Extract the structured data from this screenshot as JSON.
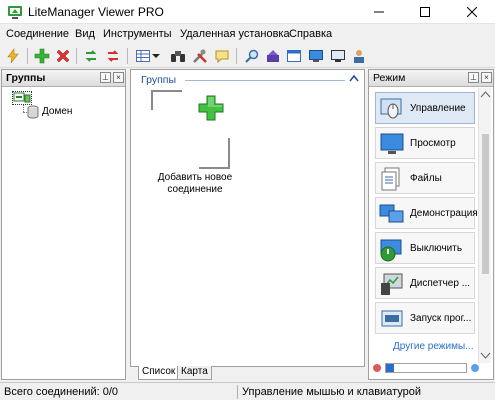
{
  "window": {
    "title": "LiteManager Viewer PRO"
  },
  "menu": [
    "Соединение",
    "Вид",
    "Инструменты",
    "Удаленная установка",
    "Справка"
  ],
  "toolbar": {
    "icons": [
      "lightning-icon",
      "add-icon",
      "delete-icon",
      "connect-icon",
      "disconnect-icon",
      "grid-view-icon",
      "dropdown-icon",
      "binoculars-icon",
      "tools-icon",
      "chat-icon",
      "search-icon",
      "send-icon",
      "window-icon",
      "monitor-icon",
      "screen-icon",
      "user-icon"
    ]
  },
  "left_panel": {
    "title": "Группы",
    "tree": {
      "domain_label": "Домен"
    }
  },
  "center_panel": {
    "title": "Группы",
    "add_connection_label": "Добавить новое соединение",
    "tabs": [
      "Список",
      "Карта"
    ]
  },
  "right_panel": {
    "title": "Режим",
    "modes": [
      {
        "label": "Управление",
        "icon": "mouse-icon",
        "selected": true
      },
      {
        "label": "Просмотр",
        "icon": "monitor-view-icon"
      },
      {
        "label": "Файлы",
        "icon": "files-icon"
      },
      {
        "label": "Демонстрация",
        "icon": "demo-icon"
      },
      {
        "label": "Выключить",
        "icon": "power-icon"
      },
      {
        "label": "Диспетчер ...",
        "icon": "task-manager-icon"
      },
      {
        "label": "Запуск прог...",
        "icon": "run-program-icon"
      }
    ],
    "more_modes_link": "Другие режимы..."
  },
  "status": {
    "connections": "Всего соединений:  0/0",
    "mode": "Управление мышью и клавиатурой"
  },
  "colors": {
    "accent": "#2b6fc9",
    "add_green": "#3cb43c",
    "delete_red": "#e03030"
  }
}
